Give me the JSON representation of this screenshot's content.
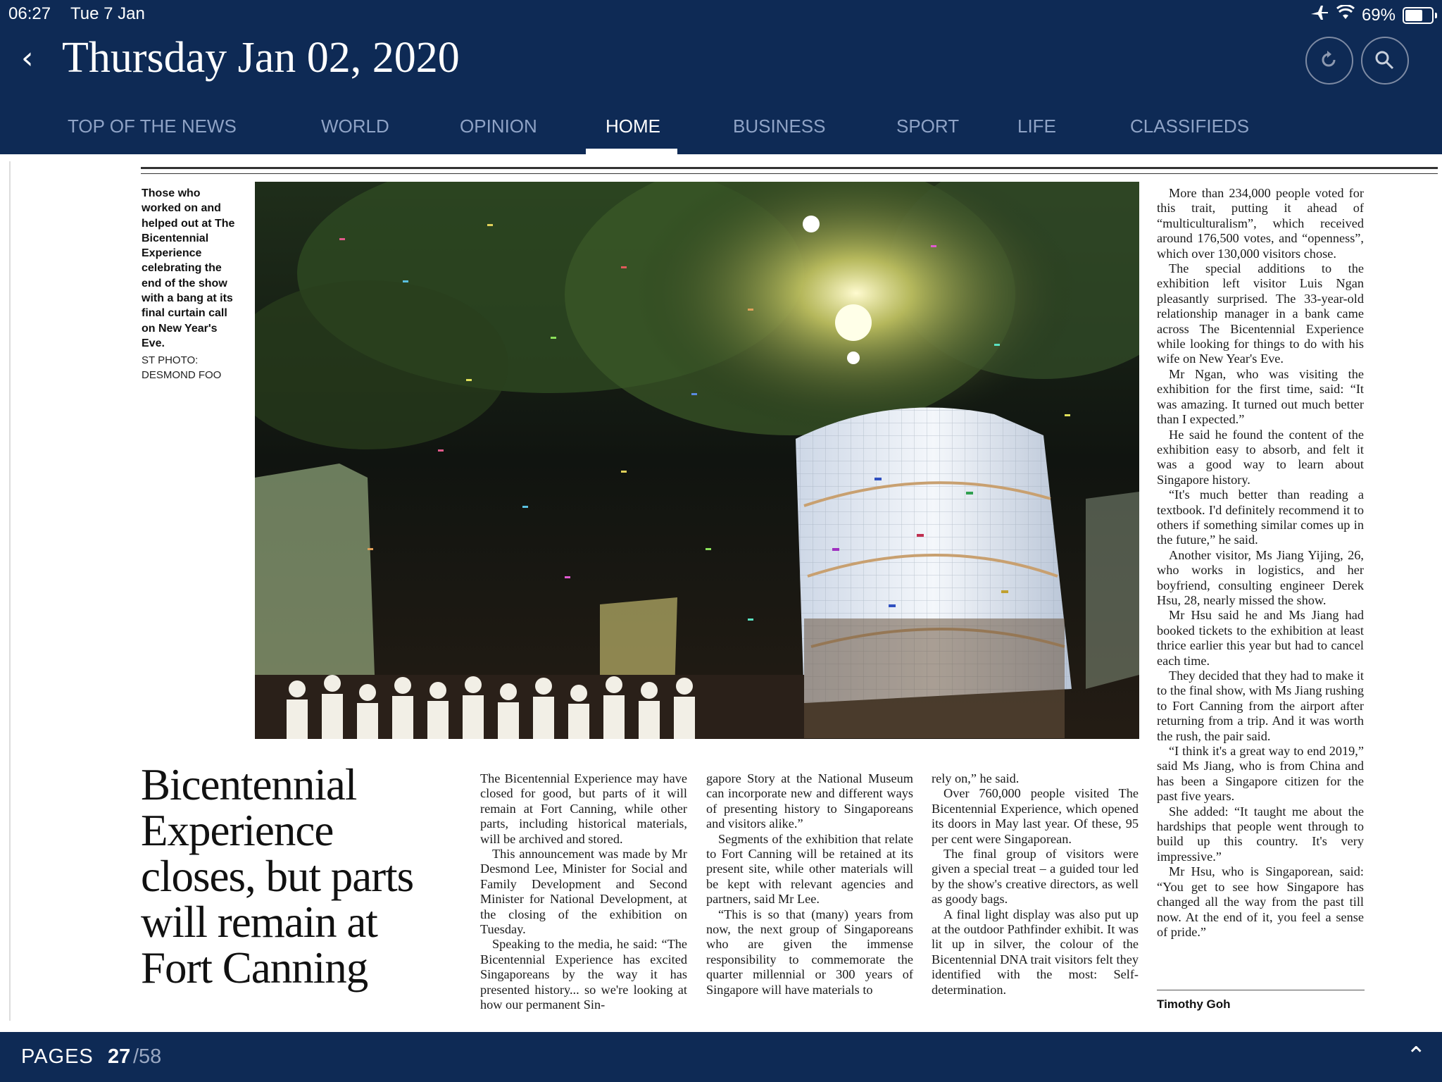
{
  "status_bar": {
    "time": "06:27",
    "date": "Tue 7 Jan",
    "battery": "69%"
  },
  "header": {
    "back_icon": "chevron-left-icon",
    "issue_date": "Thursday Jan 02, 2020"
  },
  "tabs": [
    {
      "label": "TOP OF THE NEWS"
    },
    {
      "label": "WORLD"
    },
    {
      "label": "OPINION"
    },
    {
      "label": "HOME",
      "active": true
    },
    {
      "label": "BUSINESS"
    },
    {
      "label": "SPORT"
    },
    {
      "label": "LIFE"
    },
    {
      "label": "CLASSIFIEDS"
    }
  ],
  "article": {
    "caption": "Those who worked on and helped out at The Bicentennial Experience celebrating the end of the show with a bang at its final curtain call on New Year's Eve.",
    "photo_credit": "ST PHOTO: DESMOND FOO",
    "headline": "Bicentennial Experience closes, but parts will remain at Fort Canning",
    "col1": [
      "The Bicentennial Experience may have closed for good, but parts of it will remain at Fort Canning, while other parts, including historical materials, will be archived and stored.",
      "This announcement was made by Mr Desmond Lee, Minister for Social and Family Development and Second Minister for National Development, at the closing of the exhibition on Tuesday.",
      "Speaking to the media, he said: “The Bicentennial Experience has excited Singaporeans by the way it has presented history... so we're looking at how our permanent Sin-"
    ],
    "col2": [
      "gapore Story at the National Museum can incorporate new and different ways of presenting history to Singaporeans and visitors alike.”",
      "Segments of the exhibition that relate to Fort Canning will be retained at its present site, while other materials will be kept with relevant agencies and partners, said Mr Lee.",
      "“This is so that (many) years from now, the next group of Singaporeans who are given the immense responsibility to commemorate the quarter millennial or 300 years of Singapore will have materials to"
    ],
    "col3": [
      "rely on,” he said.",
      "Over 760,000 people visited The Bicentennial Experience, which opened its doors in May last year. Of these, 95 per cent were Singaporean.",
      "The final group of visitors were given a special treat – a guided tour led by the show's creative directors, as well as goody bags.",
      "A final light display was also put up at the outdoor Pathfinder exhibit. It was lit up in silver, the colour of the Bicentennial DNA trait visitors felt they identified with the most: Self-determination."
    ],
    "col4": [
      "More than 234,000 people voted for this trait, putting it ahead of “multiculturalism”, which received around 176,500 votes, and “openness”, which over 130,000 visitors chose.",
      "The special additions to the exhibition left visitor Luis Ngan pleasantly surprised. The 33-year-old relationship manager in a bank came across The Bicentennial Experience while looking for things to do with his wife on New Year's Eve.",
      "Mr Ngan, who was visiting the exhibition for the first time, said: “It was amazing. It turned out much better than I expected.”",
      "He said he found the content of the exhibition easy to absorb, and felt it was a good way to learn about Singapore history.",
      "“It's much better than reading a textbook. I'd definitely recommend it to others if something similar comes up in the future,” he said.",
      "Another visitor, Ms Jiang Yijing, 26, who works in logistics, and her boyfriend, consulting engineer Derek Hsu, 28, nearly missed the show.",
      "Mr Hsu said he and Ms Jiang had booked tickets to the exhibition at least thrice earlier this year but had to cancel each time.",
      "They decided that they had to make it to the final show, with Ms Jiang rushing to Fort Canning from the airport after returning from a trip. And it was worth the rush, the pair said.",
      "“I think it's a great way to end 2019,” said Ms Jiang, who is from China and has been a Singapore citizen for the past five years.",
      "She added: “It taught me about the hardships that people went through to build up this country. It's very impressive.”",
      "Mr Hsu, who is Singaporean, said: “You get to see how Singapore has changed all the way from the past till now. At the end of it, you feel a sense of pride.”"
    ],
    "byline": "Timothy Goh"
  },
  "footer": {
    "pages_label": "PAGES",
    "current_page": "27",
    "total_pages": "/58"
  },
  "colors": {
    "navy": "#0e2a55",
    "tab_inactive": "#8fa3c6"
  }
}
